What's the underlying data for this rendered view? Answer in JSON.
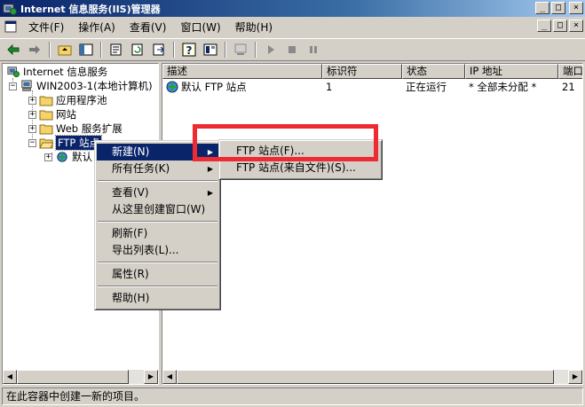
{
  "window": {
    "title": "Internet 信息服务(IIS)管理器",
    "controls": [
      "_",
      "□",
      "×"
    ]
  },
  "menubar": {
    "items": [
      "文件(F)",
      "操作(A)",
      "查看(V)",
      "窗口(W)",
      "帮助(H)"
    ]
  },
  "tree": {
    "root": "Internet 信息服务",
    "computer": "WIN2003-1(本地计算机)",
    "app_pools": "应用程序池",
    "websites": "网站",
    "web_ext": "Web 服务扩展",
    "ftp_sites": "FTP 站点",
    "default_child": "默认"
  },
  "list": {
    "columns": [
      "描述",
      "标识符",
      "状态",
      "IP 地址",
      "端口"
    ],
    "rows": [
      {
        "desc": "默认 FTP 站点",
        "id": "1",
        "state": "正在运行",
        "ip": "* 全部未分配 *",
        "port": "21"
      }
    ]
  },
  "context_menu": {
    "items": [
      {
        "label": "新建(N)",
        "submenu": true,
        "highlighted": true
      },
      {
        "label": "所有任务(K)",
        "submenu": true
      },
      {
        "sep": true
      },
      {
        "label": "查看(V)",
        "submenu": true
      },
      {
        "label": "从这里创建窗口(W)"
      },
      {
        "sep": true
      },
      {
        "label": "刷新(F)"
      },
      {
        "label": "导出列表(L)..."
      },
      {
        "sep": true
      },
      {
        "label": "属性(R)"
      },
      {
        "sep": true
      },
      {
        "label": "帮助(H)"
      }
    ]
  },
  "submenu": {
    "items": [
      "FTP 站点(F)...",
      "FTP 站点(来自文件)(S)..."
    ]
  },
  "status": {
    "text": "在此容器中创建一新的项目。"
  },
  "colors": {
    "titlebar": "#0a246a",
    "highlight": "#0a246a",
    "annotation": "#ee2a33"
  }
}
